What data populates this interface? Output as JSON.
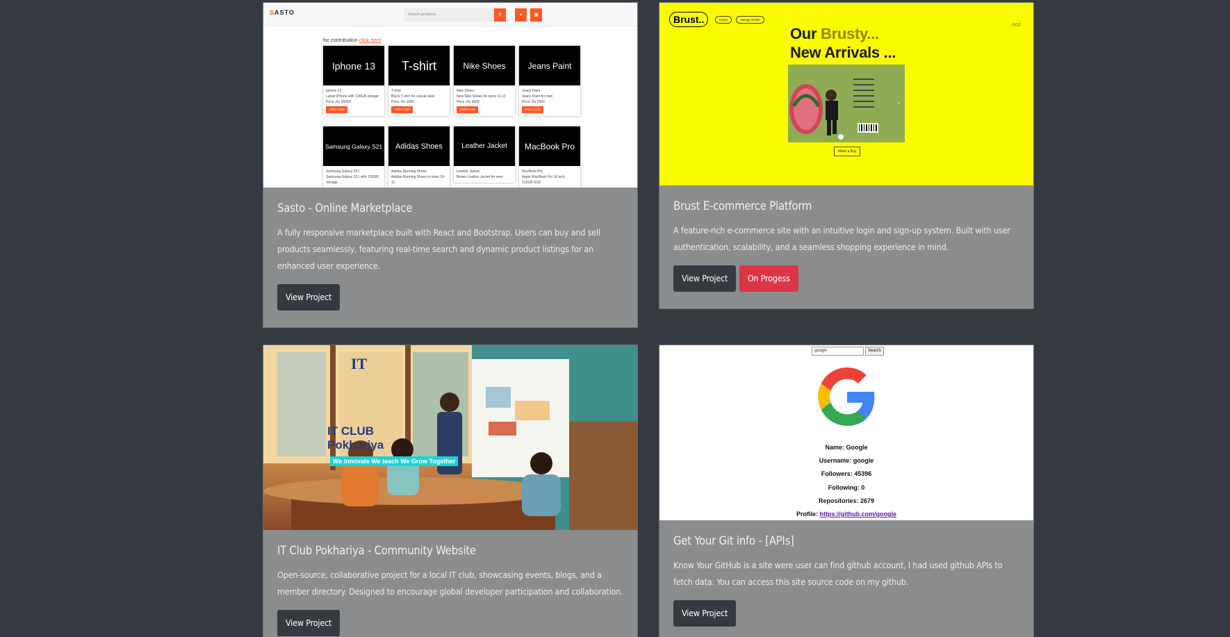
{
  "cards": [
    {
      "title": "Sasto - Online Marketplace",
      "description": "A fully responsive marketplace built with React and Bootstrap. Users can buy and sell products seamlessly, featuring real-time search and dynamic product listings for an enhanced user experience.",
      "buttons": [
        "View Project"
      ]
    },
    {
      "title": "Brust E-commerce Platform",
      "description": "A feature-rich e-commerce site with an intuitive login and sign-up system. Built with user authentication, scalability, and a seamless shopping experience in mind.",
      "buttons": [
        "View Project",
        "On Progess"
      ]
    },
    {
      "title": "IT Club Pokhariya - Community Website",
      "description": "Open-source, collaborative project for a local IT club, showcasing events, blogs, and a member directory. Designed to encourage global developer participation and collaboration.",
      "buttons": [
        "View Project"
      ]
    },
    {
      "title": "Get Your Git info - [APIs]",
      "description": "Know Your GitHub is a site were user can find github account, I had used github APIs to fetch data. You can access this site source code on my github.",
      "buttons": [
        "View Project"
      ]
    }
  ],
  "sasto_preview": {
    "logo_mark": "S",
    "logo_text": "ASTO",
    "search_placeholder": "Search products...",
    "contribution_text": "for contribution",
    "contribution_link": "click here",
    "products": [
      {
        "name": "Iphone 13",
        "sub": "Iphone 13",
        "desc": "Latest iPhone with 128GB storage",
        "price": "Price: Rs 95000"
      },
      {
        "name": "T-shirt",
        "sub": "T-shirt",
        "desc": "Black T-shirt for casual wear",
        "price": "Price: Rs 1000"
      },
      {
        "name": "Nike Shoes",
        "sub": "Nike Shoes",
        "desc": "New Nike Shoes for sizes 11-12",
        "price": "Price: Rs 5000"
      },
      {
        "name": "Jeans Paint",
        "sub": "Jeans Paint",
        "desc": "Jeans Paint for men",
        "price": "Price: Rs 2500"
      },
      {
        "name": "Samsung Galaxy S21",
        "sub": "Samsung Galaxy S21",
        "desc": "Samsung Galaxy S21 with 128GB storage",
        "price": ""
      },
      {
        "name": "Adidas Shoes",
        "sub": "Adidas Running Shoes",
        "desc": "Adidas Running Shoes in sizes 10-11",
        "price": ""
      },
      {
        "name": "Leather Jacket",
        "sub": "Leather Jacket",
        "desc": "Brown Leather Jacket for men",
        "price": ""
      },
      {
        "name": "MacBook Pro",
        "sub": "MacBook Pro",
        "desc": "Apple MacBook Pro 16 inch, 512GB SSD",
        "price": ""
      }
    ],
    "add_to_cart": "Add to Cart"
  },
  "brust_preview": {
    "logo": "Brust..",
    "nav": [
      "Home",
      "Viewgy Online"
    ],
    "headline_1a": "Our ",
    "headline_1b": "Brusty...",
    "headline_2": "New Arrivals ...",
    "shop_button": "Make a Buy"
  },
  "itclub_preview": {
    "logo": "IT",
    "title_1": "IT CLUB",
    "title_2": "Pokhariya",
    "tagline": "We innovate  We teach  We Grow Together"
  },
  "git_preview": {
    "search_value": "google",
    "search_button": "Search",
    "name": "Name: Google",
    "username": "Username: google",
    "followers": "Followers: 45396",
    "following": "Following: 0",
    "repositories": "Repositories: 2679",
    "profile_label": "Profile: ",
    "profile_url": "https://github.com/google"
  },
  "colors": {
    "page_bg": "#343a40",
    "card_bg": "#8a8c8e",
    "button_dark": "#343a40",
    "button_red": "#dc3545",
    "sasto_accent": "#ff5722",
    "brust_yellow": "#fafa00"
  }
}
